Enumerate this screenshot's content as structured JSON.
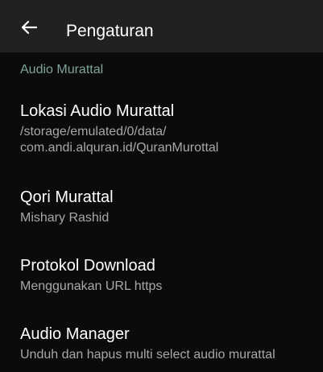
{
  "appbar": {
    "title": "Pengaturan",
    "back_icon": "arrow-left-icon"
  },
  "section": {
    "header": "Audio Murattal"
  },
  "preferences": [
    {
      "title": "Lokasi Audio Murattal",
      "summary_lines": [
        "/storage/emulated/0/data/",
        "com.andi.alquran.id/QuranMurottal"
      ]
    },
    {
      "title": "Qori Murattal",
      "summary_lines": [
        "Mishary Rashid"
      ]
    },
    {
      "title": "Protokol Download",
      "summary_lines": [
        "Menggunakan URL https"
      ]
    },
    {
      "title": "Audio Manager",
      "summary_lines": [
        "Unduh dan hapus multi select audio murattal"
      ]
    }
  ],
  "colors": {
    "appbar_bg": "#212121",
    "content_bg": "#0b0b0b",
    "section_header": "#7fa39c",
    "title_text": "#ffffff",
    "summary_text": "#a8a8a8"
  }
}
